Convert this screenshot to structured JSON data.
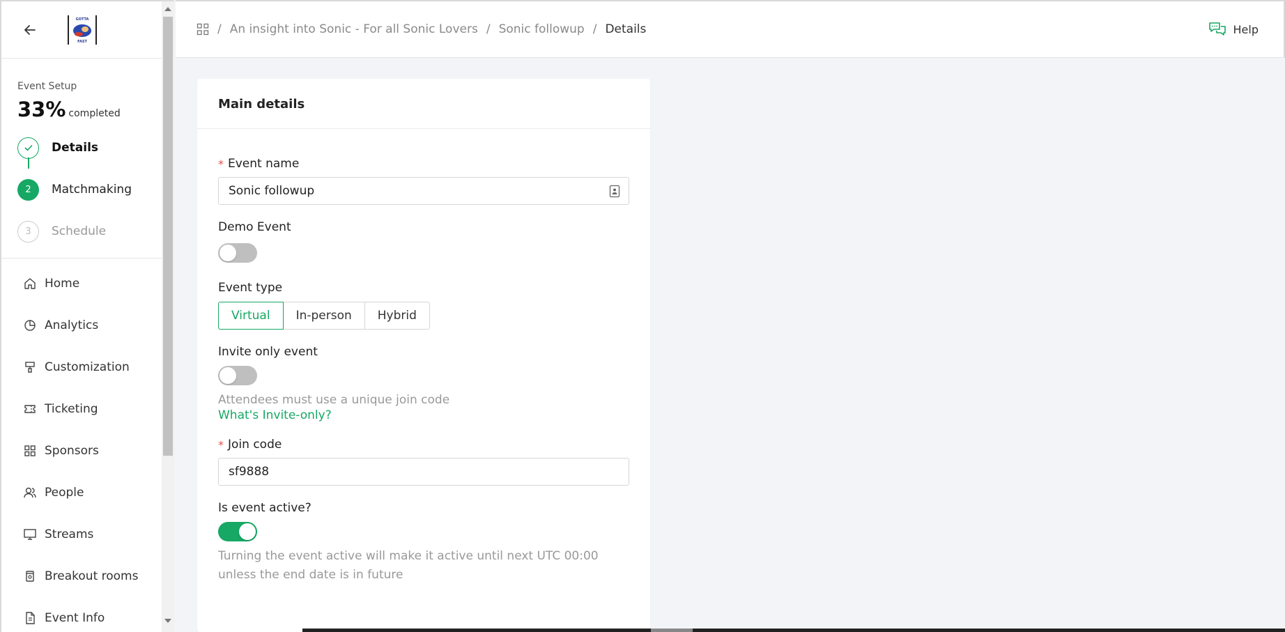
{
  "sidebar": {
    "setup_label": "Event Setup",
    "progress_percent": "33%",
    "progress_suffix": "completed",
    "steps": [
      {
        "number": "",
        "label": "Details",
        "status": "done"
      },
      {
        "number": "2",
        "label": "Matchmaking",
        "status": "active"
      },
      {
        "number": "3",
        "label": "Schedule",
        "status": "todo"
      }
    ],
    "nav": [
      {
        "label": "Home",
        "icon": "home-icon"
      },
      {
        "label": "Analytics",
        "icon": "pie-chart-icon"
      },
      {
        "label": "Customization",
        "icon": "paint-brush-icon"
      },
      {
        "label": "Ticketing",
        "icon": "ticket-icon"
      },
      {
        "label": "Sponsors",
        "icon": "grid-icon"
      },
      {
        "label": "People",
        "icon": "people-icon"
      },
      {
        "label": "Streams",
        "icon": "monitor-icon"
      },
      {
        "label": "Breakout rooms",
        "icon": "breakout-icon"
      },
      {
        "label": "Event Info",
        "icon": "document-icon"
      }
    ]
  },
  "header": {
    "breadcrumbs": [
      "An insight into Sonic - For all Sonic Lovers",
      "Sonic followup",
      "Details"
    ],
    "help_label": "Help"
  },
  "card": {
    "title": "Main details",
    "event_name_label": "Event name",
    "event_name_value": "Sonic followup",
    "demo_event_label": "Demo Event",
    "demo_event_on": false,
    "event_type_label": "Event type",
    "event_type_options": [
      "Virtual",
      "In-person",
      "Hybrid"
    ],
    "event_type_selected": "Virtual",
    "invite_only_label": "Invite only event",
    "invite_only_on": false,
    "invite_only_hint": "Attendees must use a unique join code",
    "invite_only_link": "What's Invite-only?",
    "join_code_label": "Join code",
    "join_code_value": "sf9888",
    "active_label": "Is event active?",
    "active_on": true,
    "active_hint": "Turning the event active will make it active until next UTC 00:00 unless the end date is in future"
  },
  "colors": {
    "accent": "#16a864",
    "required": "#e4524d"
  }
}
